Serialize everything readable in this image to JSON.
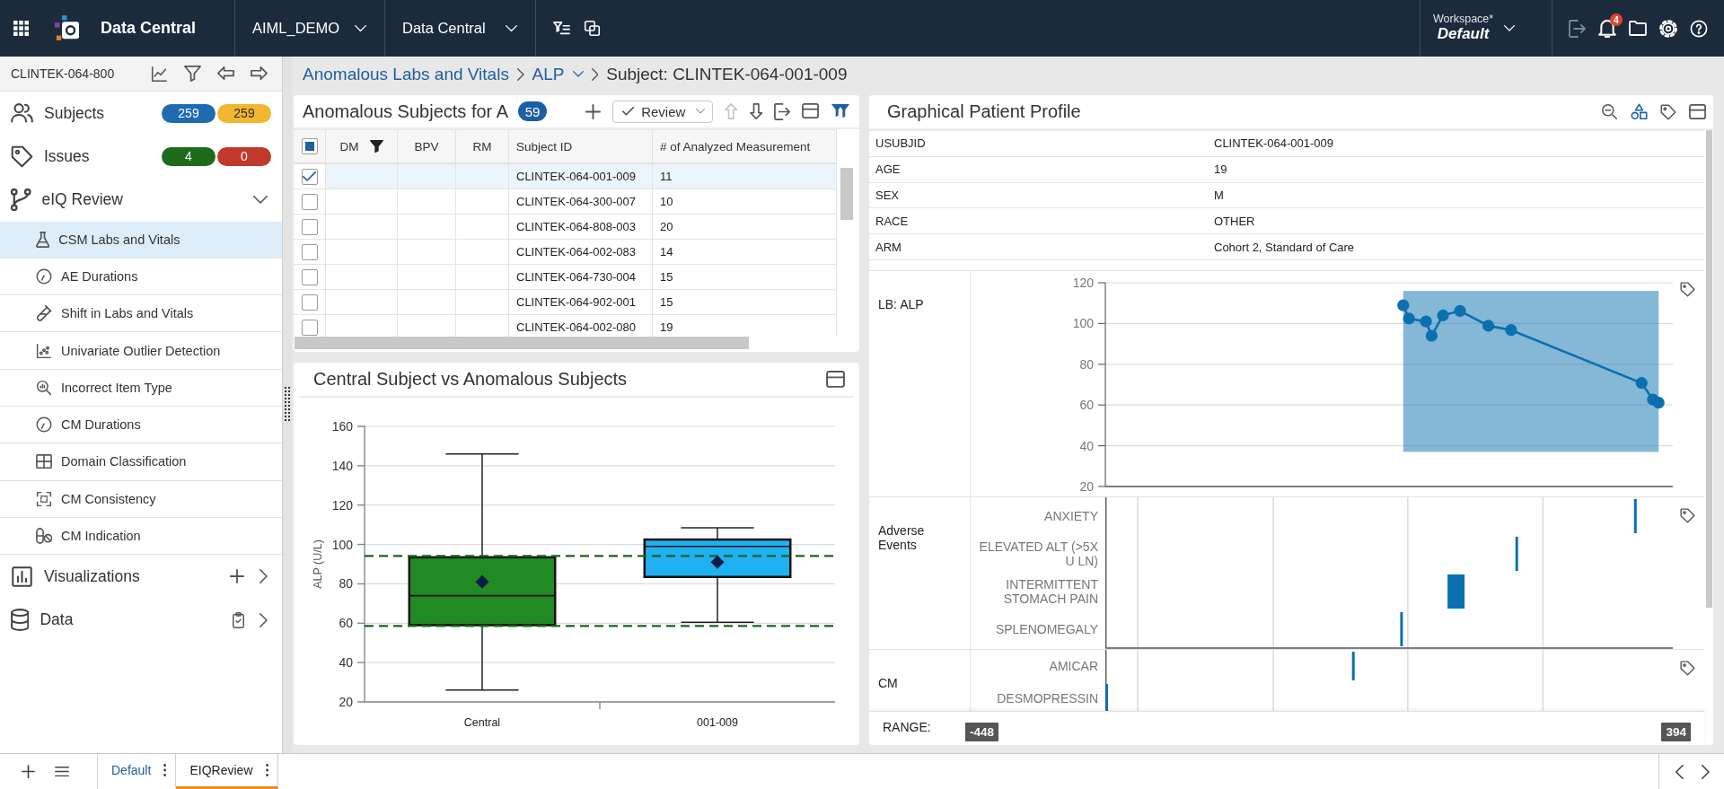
{
  "header": {
    "app_title": "Data Central",
    "project": "AIML_DEMO",
    "module": "Data Central",
    "workspace_label": "Workspace*",
    "workspace_name": "Default",
    "notification_count": "4"
  },
  "context": {
    "study": "CLINTEK-064-800"
  },
  "breadcrumb": [
    {
      "kind": "link",
      "label": "Anomalous Labs and Vitals"
    },
    {
      "kind": "dropdown",
      "label": "ALP"
    },
    {
      "kind": "current",
      "label": "Subject: CLINTEK-064-001-009"
    }
  ],
  "sidebar": {
    "summary": [
      {
        "label": "Subjects",
        "badges": [
          {
            "text": "259",
            "color": "#1f6bb2"
          },
          {
            "text": "259",
            "color": "#f2b630"
          }
        ]
      },
      {
        "label": "Issues",
        "badges": [
          {
            "text": "4",
            "color": "#1e6b1e"
          },
          {
            "text": "0",
            "color": "#c0392b"
          }
        ]
      }
    ],
    "groups": [
      {
        "kind": "review",
        "label": "eIQ Review",
        "expanded": true,
        "children": [
          {
            "label": "CSM Labs and Vitals",
            "selected": true
          },
          {
            "label": "AE Durations",
            "selected": false
          },
          {
            "label": "Shift in Labs and Vitals",
            "selected": false
          },
          {
            "label": "Univariate Outlier Detection",
            "selected": false
          },
          {
            "label": "Incorrect Item Type",
            "selected": false
          },
          {
            "label": "CM Durations",
            "selected": false
          },
          {
            "label": "Domain Classification",
            "selected": false
          },
          {
            "label": "CM Consistency",
            "selected": false
          },
          {
            "label": "CM Indication",
            "selected": false
          }
        ]
      },
      {
        "kind": "visualizations",
        "label": "Visualizations",
        "expanded": false
      },
      {
        "kind": "data",
        "label": "Data",
        "expanded": false
      }
    ]
  },
  "subjects_panel": {
    "title": "Anomalous Subjects for A",
    "count": "59",
    "review_button": "Review",
    "move_up_disabled": true,
    "move_down_disabled": false,
    "filter_active": true,
    "select_all_partial": true,
    "columns": [
      {
        "label": "DM",
        "filtered": true
      },
      {
        "label": "BPV",
        "filtered": false
      },
      {
        "label": "RM",
        "filtered": false
      },
      {
        "label": "Subject ID",
        "filtered": false
      },
      {
        "label": "# of Analyzed Measurement",
        "filtered": false
      }
    ],
    "rows": [
      {
        "checked": true,
        "subject_id": "CLINTEK-064-001-009",
        "measurements": "11"
      },
      {
        "checked": false,
        "subject_id": "CLINTEK-064-300-007",
        "measurements": "10"
      },
      {
        "checked": false,
        "subject_id": "CLINTEK-064-808-003",
        "measurements": "20"
      },
      {
        "checked": false,
        "subject_id": "CLINTEK-064-002-083",
        "measurements": "14"
      },
      {
        "checked": false,
        "subject_id": "CLINTEK-064-730-004",
        "measurements": "15"
      },
      {
        "checked": false,
        "subject_id": "CLINTEK-064-902-001",
        "measurements": "15"
      },
      {
        "checked": false,
        "subject_id": "CLINTEK-064-002-080",
        "measurements": "19"
      }
    ]
  },
  "boxplot_panel": {
    "title": "Central Subject vs Anomalous Subjects",
    "y_axis_title": "ALP (U/L)",
    "y_axis_labels": [
      "160",
      "140",
      "120",
      "100",
      "80",
      "60",
      "40",
      "20"
    ],
    "categories": [
      {
        "label": "Central",
        "color": "#228a22"
      },
      {
        "label": "001-009",
        "color": "#1fb1f2"
      }
    ]
  },
  "profile_panel": {
    "title": "Graphical Patient Profile",
    "demographics": [
      {
        "label": "USUBJID",
        "value": "CLINTEK-064-001-009"
      },
      {
        "label": "AGE",
        "value": "19"
      },
      {
        "label": "SEX",
        "value": "M"
      },
      {
        "label": "RACE",
        "value": "OTHER"
      },
      {
        "label": "ARM",
        "value": "Cohort 2, Standard of Care"
      }
    ],
    "tracks": [
      {
        "kind": "line",
        "label": "LB: ALP",
        "chart_data": {
          "type": "line",
          "grid": true,
          "categories": [
            null,
            null,
            null,
            null,
            null,
            null,
            null,
            null,
            null,
            null,
            null,
            null,
            null,
            null,
            null,
            null,
            null,
            null,
            null,
            null,
            null,
            null,
            null,
            null,
            null,
            null,
            null,
            null,
            null,
            null,
            null,
            null,
            null,
            null,
            null,
            null,
            null,
            null,
            null,
            null,
            null,
            null,
            null,
            null,
            null,
            null,
            null,
            null,
            null,
            null,
            null,
            null,
            null,
            null,
            null,
            null,
            null,
            null,
            null,
            null,
            null,
            null,
            null,
            null,
            null,
            null,
            null,
            null,
            null,
            null,
            null,
            null,
            null,
            null,
            null,
            null,
            null,
            null,
            null,
            null,
            null,
            null,
            null,
            null,
            null,
            null,
            null,
            null,
            null,
            null,
            null,
            null,
            null,
            null,
            null,
            null,
            null,
            null,
            null,
            null
          ],
          "ylim": [
            20,
            120
          ],
          "yticks": [
            20,
            40,
            60,
            80,
            100,
            120
          ],
          "bands": [
            {
              "axis": "y",
              "from": 37,
              "to": 116
            }
          ],
          "series": [
            {
              "color": "#0b70b0",
              "marker": "circle",
              "values": [
                null,
                null,
                null,
                null,
                null,
                null,
                null,
                null,
                null,
                null,
                null,
                null,
                null,
                null,
                null,
                null,
                null,
                null,
                null,
                null,
                null,
                null,
                null,
                null,
                null,
                null,
                null,
                null,
                null,
                null,
                null,
                null,
                null,
                null,
                null,
                null,
                null,
                null,
                null,
                null,
                null,
                null,
                null,
                null,
                null,
                null,
                null,
                null,
                null,
                null,
                null,
                null,
                108.9,
                102.4,
                null,
                null,
                101,
                94,
                null,
                104,
                null,
                null,
                106.2,
                null,
                null,
                null,
                null,
                98.9,
                null,
                null,
                null,
                96.8,
                null,
                null,
                null,
                null,
                null,
                null,
                null,
                null,
                null,
                null,
                null,
                null,
                null,
                null,
                null,
                null,
                null,
                null,
                null,
                null,
                null,
                null,
                70.8,
                null,
                62.7,
                61.1,
                null,
                null
              ]
            }
          ]
        }
      },
      {
        "kind": "events",
        "label": "Adverse Events",
        "events": [
          "ANXIETY",
          "ELEVATED ALT (>5X U LN)",
          "INTERMITTENT STOMACH PAIN",
          "SPLENOMEGALY"
        ]
      },
      {
        "kind": "events",
        "label": "CM",
        "events": [
          "AMICAR",
          "DESMOPRESSIN"
        ]
      }
    ],
    "range": {
      "label": "RANGE:",
      "start": "-448",
      "end": "394"
    }
  },
  "bottom_bar": {
    "tabs": [
      {
        "label": "Default",
        "selected": false
      },
      {
        "label": "EIQReview",
        "selected": true
      }
    ]
  }
}
